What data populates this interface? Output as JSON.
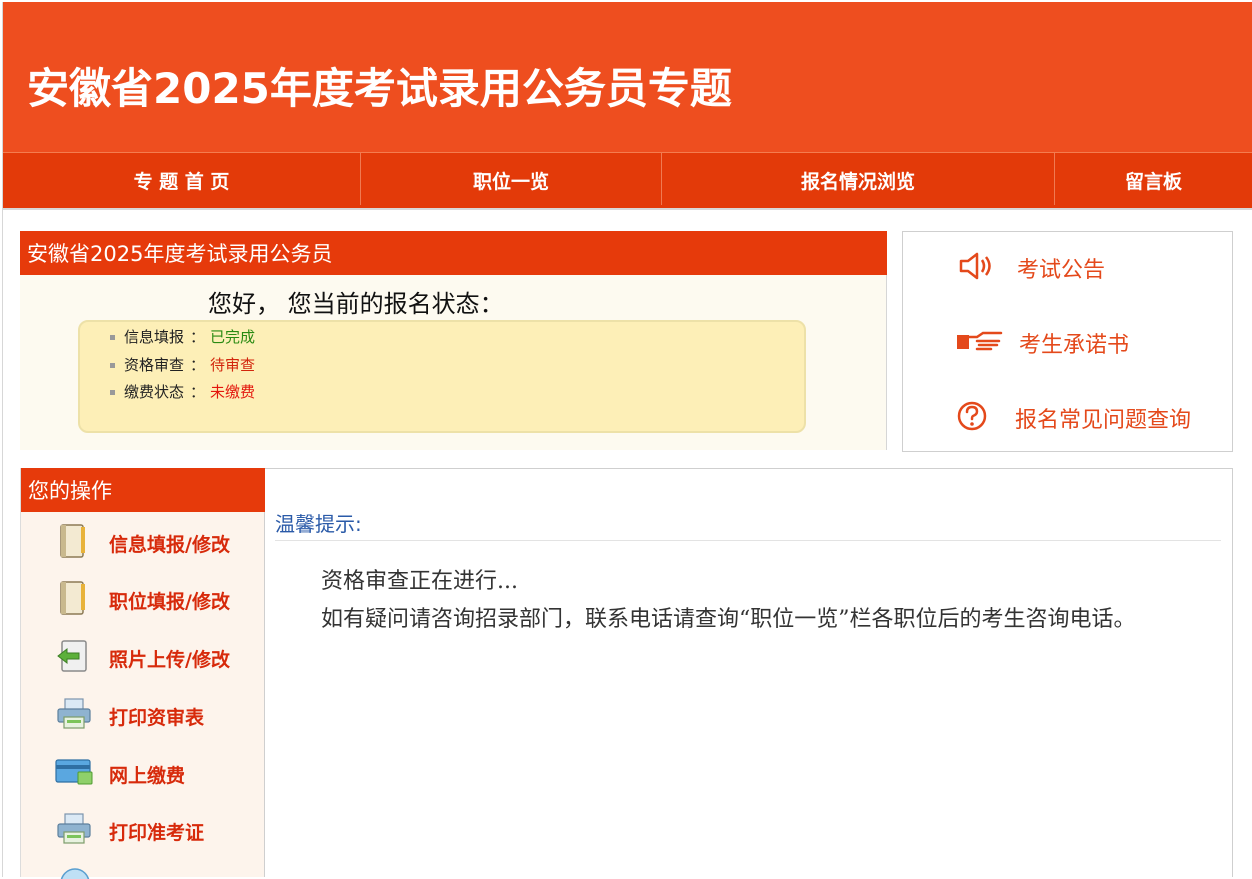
{
  "header": {
    "title": "安徽省2025年度考试录用公务员专题"
  },
  "nav": {
    "items": [
      {
        "label": "专 题 首 页"
      },
      {
        "label": "职位一览"
      },
      {
        "label": "报名情况浏览"
      },
      {
        "label": "留言板"
      }
    ]
  },
  "status": {
    "panel_title": "安徽省2025年度考试录用公务员",
    "greeting": "您好， 您当前的报名状态：",
    "rows": [
      {
        "label": "信息填报",
        "value": "已完成",
        "color": "#2a8a12"
      },
      {
        "label": "资格审查",
        "value": "待审查",
        "color": "#d2260c"
      },
      {
        "label": "缴费状态",
        "value": "未缴费",
        "color": "#e3160c"
      }
    ],
    "colon": "："
  },
  "links": {
    "items": [
      {
        "label": "考试公告",
        "icon": "speaker-icon"
      },
      {
        "label": "考生承诺书",
        "icon": "pointing-hand-icon"
      },
      {
        "label": "报名常见问题查询",
        "icon": "question-circle-icon"
      }
    ]
  },
  "ops": {
    "title": "您的操作",
    "items": [
      {
        "label": "信息填报/修改",
        "icon": "notebook-icon"
      },
      {
        "label": "职位填报/修改",
        "icon": "notebook-icon"
      },
      {
        "label": "照片上传/修改",
        "icon": "photo-upload-icon"
      },
      {
        "label": "打印资审表",
        "icon": "printer-icon"
      },
      {
        "label": "网上缴费",
        "icon": "payment-card-icon"
      },
      {
        "label": "打印准考证",
        "icon": "printer-icon"
      }
    ]
  },
  "tip": {
    "title": "温馨提示:",
    "lines": [
      "资格审查正在进行...",
      "如有疑问请咨询招录部门，联系电话请查询“职位一览”栏各职位后的考生咨询电话。"
    ]
  },
  "colors": {
    "banner": "#ee4e1f",
    "nav": "#e33a09",
    "accent": "#e63a0b",
    "link_text": "#e4491b"
  }
}
